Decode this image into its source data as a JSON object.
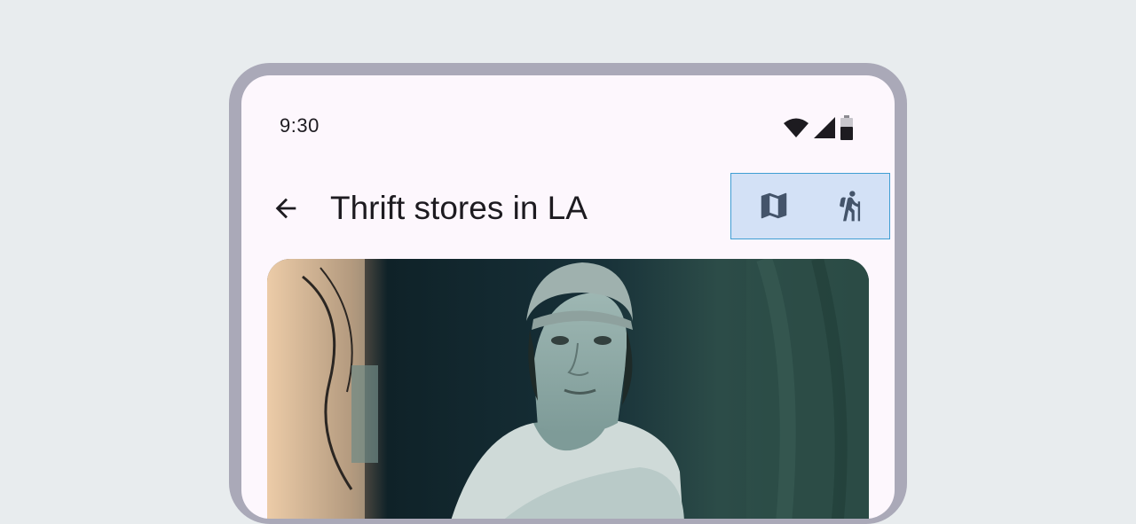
{
  "status_bar": {
    "time": "9:30",
    "icons": [
      "wifi-icon",
      "cellular-signal-icon",
      "battery-icon"
    ]
  },
  "top_bar": {
    "back_icon": "arrow-back-icon",
    "title": "Thrift stores in LA",
    "actions": [
      {
        "icon": "map-icon"
      },
      {
        "icon": "hiking-icon"
      }
    ]
  },
  "content": {
    "photo": "portrait of man wearing beanie"
  },
  "colors": {
    "background": "#e8ecee",
    "frame": "#aaa9b8",
    "screen": "#fdf7fd",
    "action_highlight": "#d3e1f6",
    "action_border": "#3f9ed3",
    "icon": "#44546a",
    "text": "#1d1b20"
  }
}
